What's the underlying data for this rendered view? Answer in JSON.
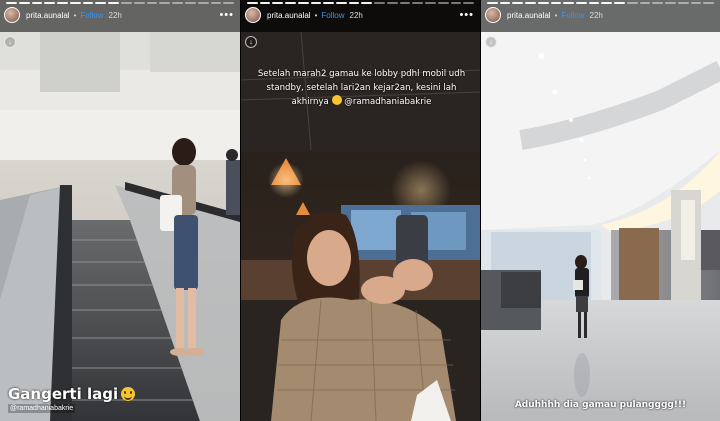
{
  "stories": [
    {
      "username": "prita.aunalal",
      "follow_label": "Follow",
      "time": "22h",
      "menu": "•••",
      "caption": "Gangerti lagi",
      "mention": "@ramadhaniabakrie"
    },
    {
      "username": "prita.aunalal",
      "follow_label": "Follow",
      "time": "22h",
      "menu": "•••",
      "text": "Setelah marah2 gamau ke lobby pdhl mobil udh standby, setelah lari2an kejar2an, kesini lah akhirnya",
      "mention": "@ramadhaniabakrie"
    },
    {
      "username": "prita.aunalal",
      "follow_label": "Follow",
      "time": "22h",
      "menu": "•••",
      "caption": "Aduhhhh dia gamau pulangggg!!!"
    }
  ],
  "colors": {
    "follow": "#3897f0",
    "overlay": "#000000"
  },
  "icons": {
    "download": "download-icon",
    "menu": "more-dots-icon",
    "emoji": "smiley-emoji-icon"
  }
}
